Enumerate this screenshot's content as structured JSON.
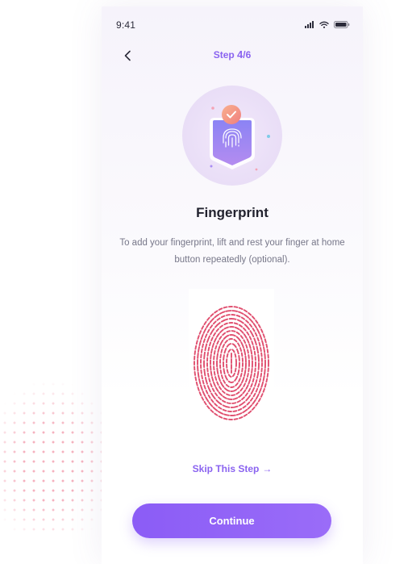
{
  "status_bar": {
    "time": "9:41",
    "icons": [
      "signal-icon",
      "wifi-icon",
      "battery-icon"
    ]
  },
  "nav": {
    "back_icon": "chevron-left-icon",
    "step_prefix": "Step ",
    "step_current": "4",
    "step_total": "/6"
  },
  "illustration": {
    "icons": [
      "fingerprint-shield-icon",
      "check-badge-icon"
    ]
  },
  "content": {
    "title": "Fingerprint",
    "description": "To add your fingerprint, lift and rest your finger at home button repeatedly  (optional)."
  },
  "fingerprint": {
    "icon": "fingerprint-icon",
    "color": "#e04f6f"
  },
  "actions": {
    "skip_label": "Skip This Step",
    "skip_arrow": "→",
    "continue_label": "Continue"
  },
  "colors": {
    "accent": "#8a63f0",
    "button": "#8b5cf6",
    "check_badge": "#f79d84",
    "shield_top": "#8b83f4",
    "shield_bottom": "#b48cf0"
  }
}
